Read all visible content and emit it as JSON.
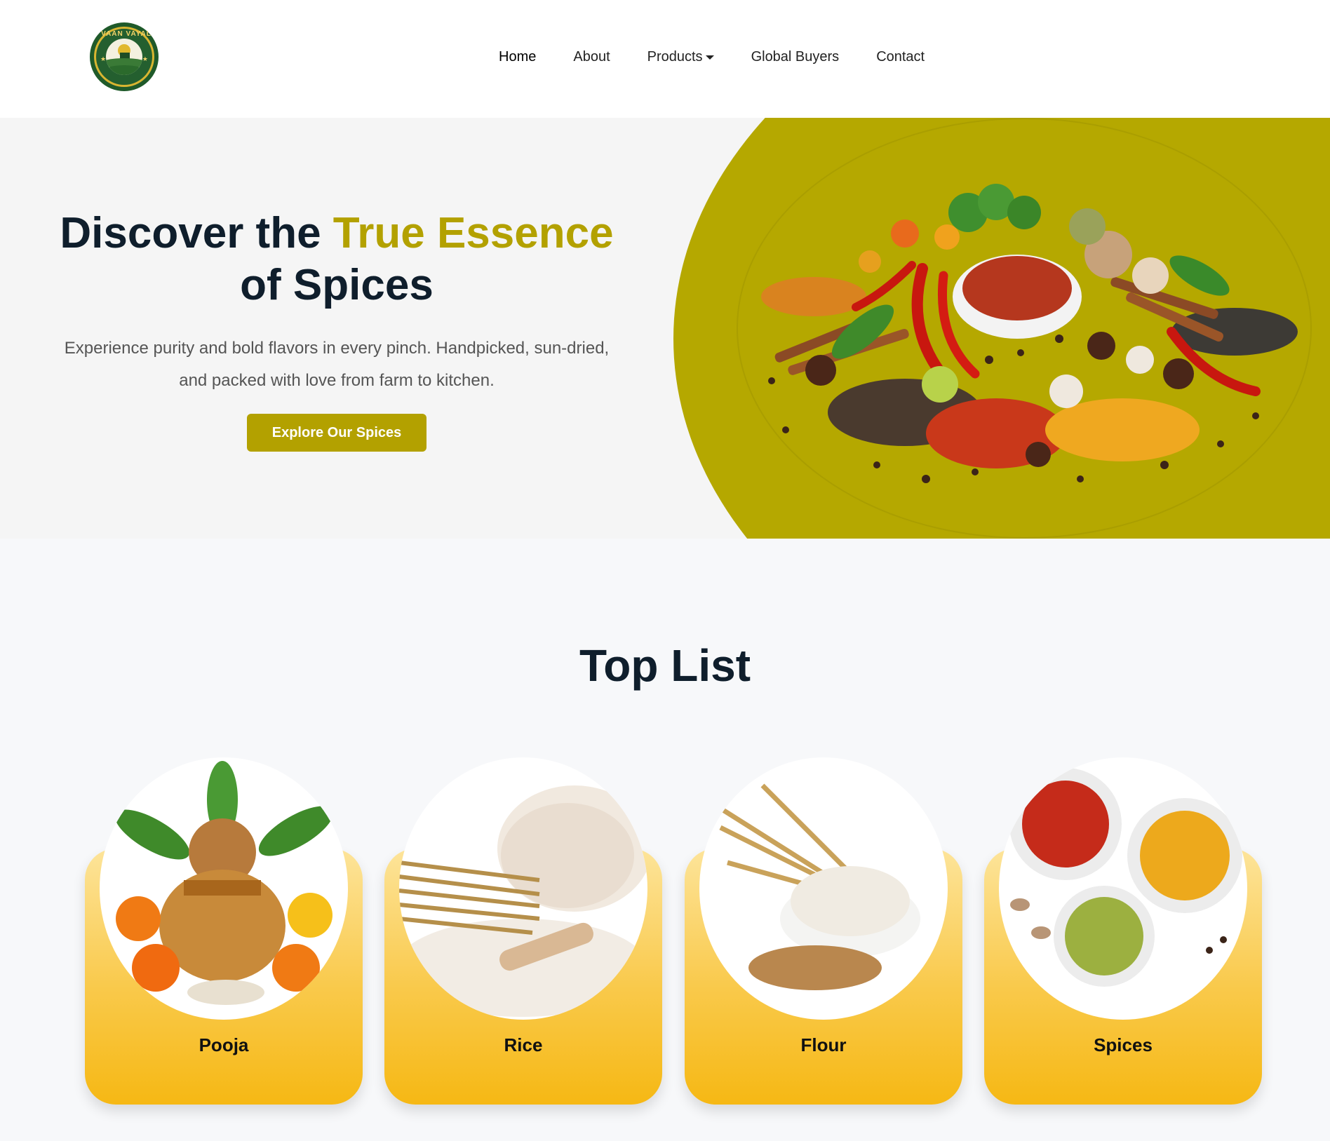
{
  "nav": {
    "logo_text": "VAAN VAYAL",
    "items": [
      {
        "label": "Home",
        "active": true
      },
      {
        "label": "About"
      },
      {
        "label": "Products",
        "dropdown": true
      },
      {
        "label": "Global Buyers"
      },
      {
        "label": "Contact"
      }
    ]
  },
  "hero": {
    "title_part1": "Discover the ",
    "title_accent": "True Essence",
    "title_part2": "of Spices",
    "subtitle": "Experience purity and bold flavors in every pinch. Handpicked, sun-dried, and packed with love from farm to kitchen.",
    "cta_label": "Explore Our Spices",
    "accent_color": "#b3a100"
  },
  "top_list": {
    "title": "Top List",
    "cards": [
      {
        "label": "Pooja"
      },
      {
        "label": "Rice"
      },
      {
        "label": "Flour"
      },
      {
        "label": "Spices"
      }
    ]
  }
}
